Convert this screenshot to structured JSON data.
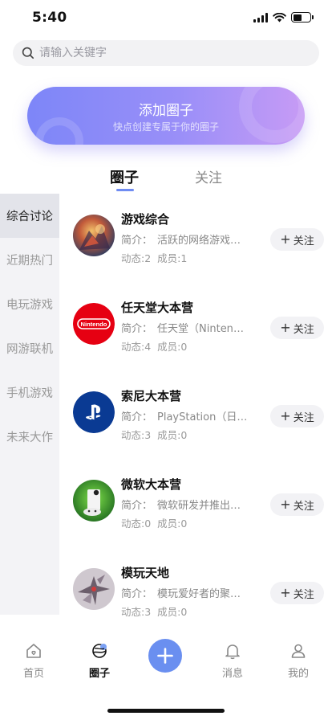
{
  "status_bar": {
    "time": "5:40",
    "battery_level": 0.5
  },
  "search": {
    "placeholder": "请输入关键字",
    "icon": "search-icon"
  },
  "banner": {
    "title": "添加圈子",
    "subtitle": "快点创建专属于你的圈子"
  },
  "tabs": [
    {
      "label": "圈子",
      "active": true
    },
    {
      "label": "关注",
      "active": false
    }
  ],
  "sidebar": {
    "items": [
      {
        "label": "综合讨论",
        "active": true
      },
      {
        "label": "近期热门",
        "active": false
      },
      {
        "label": "电玩游戏",
        "active": false
      },
      {
        "label": "网游联机",
        "active": false
      },
      {
        "label": "手机游戏",
        "active": false
      },
      {
        "label": "未来大作",
        "active": false
      }
    ]
  },
  "circles": [
    {
      "name": "游戏综合",
      "desc_label": "简介：",
      "desc": "活跃的网络游戏综合讨论",
      "posts": "动态:2",
      "members": "成员:1",
      "follow_label": "关注",
      "avatar": "game-art"
    },
    {
      "name": "任天堂大本营",
      "desc_label": "简介：",
      "desc": "任天堂（Nintendo）",
      "posts": "动态:4",
      "members": "成员:0",
      "follow_label": "关注",
      "avatar": "nintendo-logo",
      "avatar_text": "Nintendo"
    },
    {
      "name": "索尼大本营",
      "desc_label": "简介：",
      "desc": "PlayStation（日语：プレイステーション）",
      "posts": "动态:3",
      "members": "成员:0",
      "follow_label": "关注",
      "avatar": "playstation-logo"
    },
    {
      "name": "微软大本营",
      "desc_label": "简介：",
      "desc": "微软研发并推出的家用游戏机",
      "posts": "动态:0",
      "members": "成员:0",
      "follow_label": "关注",
      "avatar": "xbox-console"
    },
    {
      "name": "模玩天地",
      "desc_label": "简介：",
      "desc": "模玩爱好者的聚集地",
      "posts": "动态:3",
      "members": "成员:0",
      "follow_label": "关注",
      "avatar": "model-figure"
    }
  ],
  "bottom_nav": {
    "items": [
      {
        "label": "首页",
        "icon": "home-icon",
        "active": false
      },
      {
        "label": "圈子",
        "icon": "planet-icon",
        "active": true
      },
      {
        "label": "",
        "icon": "plus-icon",
        "active": false
      },
      {
        "label": "消息",
        "icon": "bell-icon",
        "active": false
      },
      {
        "label": "我的",
        "icon": "user-icon",
        "active": false
      }
    ]
  },
  "colors": {
    "accent": "#6a8ff0",
    "banner_start": "#7d86f8",
    "banner_end": "#c79bf5",
    "nintendo_red": "#e60012",
    "playstation_blue": "#003791"
  }
}
